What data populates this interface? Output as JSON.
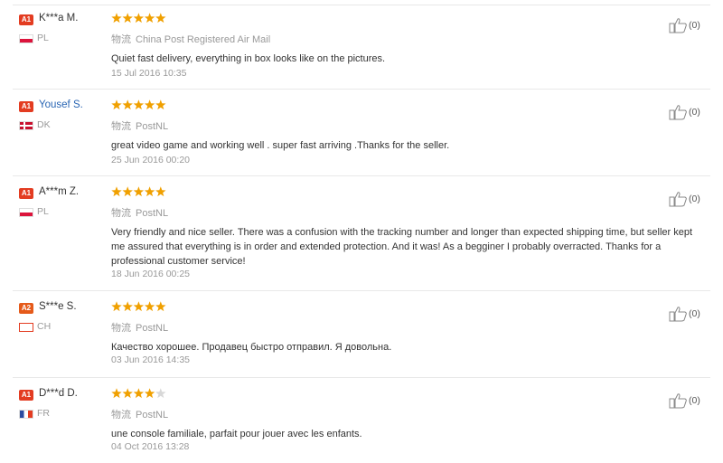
{
  "reviews": [
    {
      "badge": "A1",
      "name": "K***a M.",
      "country": "PL",
      "flag": "pl",
      "stars": 5,
      "shipping_prefix": "物流",
      "shipping": "China Post Registered Air Mail",
      "text": "Quiet fast delivery, everything in box looks like on the pictures.",
      "date": "15 Jul 2016 10:35",
      "helpful": "(0)"
    },
    {
      "badge": "A1",
      "name": "Yousef S.",
      "country": "DK",
      "flag": "dk",
      "stars": 5,
      "shipping_prefix": "物流",
      "shipping": "PostNL",
      "text": "great video game and working well . super fast arriving .Thanks for the seller.",
      "date": "25 Jun 2016 00:20",
      "helpful": "(0)"
    },
    {
      "badge": "A1",
      "name": "A***m Z.",
      "country": "PL",
      "flag": "pl",
      "stars": 5,
      "shipping_prefix": "物流",
      "shipping": "PostNL",
      "text": "Very friendly and nice seller. There was a confusion with the tracking number and longer than expected shipping time, but seller kept me assured that everything is in order and extended protection. And it was! As a begginer I probably overracted. Thanks for a professional customer service!",
      "date": "18 Jun 2016 00:25",
      "helpful": "(0)"
    },
    {
      "badge": "A2",
      "name": "S***e S.",
      "country": "CH",
      "flag": "ch",
      "stars": 5,
      "shipping_prefix": "物流",
      "shipping": "PostNL",
      "text": "Качество хорошее. Продавец быстро отправил. Я довольна.",
      "date": "03 Jun 2016 14:35",
      "helpful": "(0)"
    },
    {
      "badge": "A1",
      "name": "D***d D.",
      "country": "FR",
      "flag": "fr",
      "stars": 4,
      "shipping_prefix": "物流",
      "shipping": "PostNL",
      "text": "une console familiale, parfait pour jouer avec les enfants.",
      "date": "04 Oct 2016 13:28",
      "helpful": "(0)"
    }
  ],
  "colors": {
    "star_on": "#f0a000",
    "star_off": "#d8d8d8",
    "badge_a1": "#e33c21",
    "badge_a2": "#e55a1a",
    "link": "#2a66b4"
  }
}
